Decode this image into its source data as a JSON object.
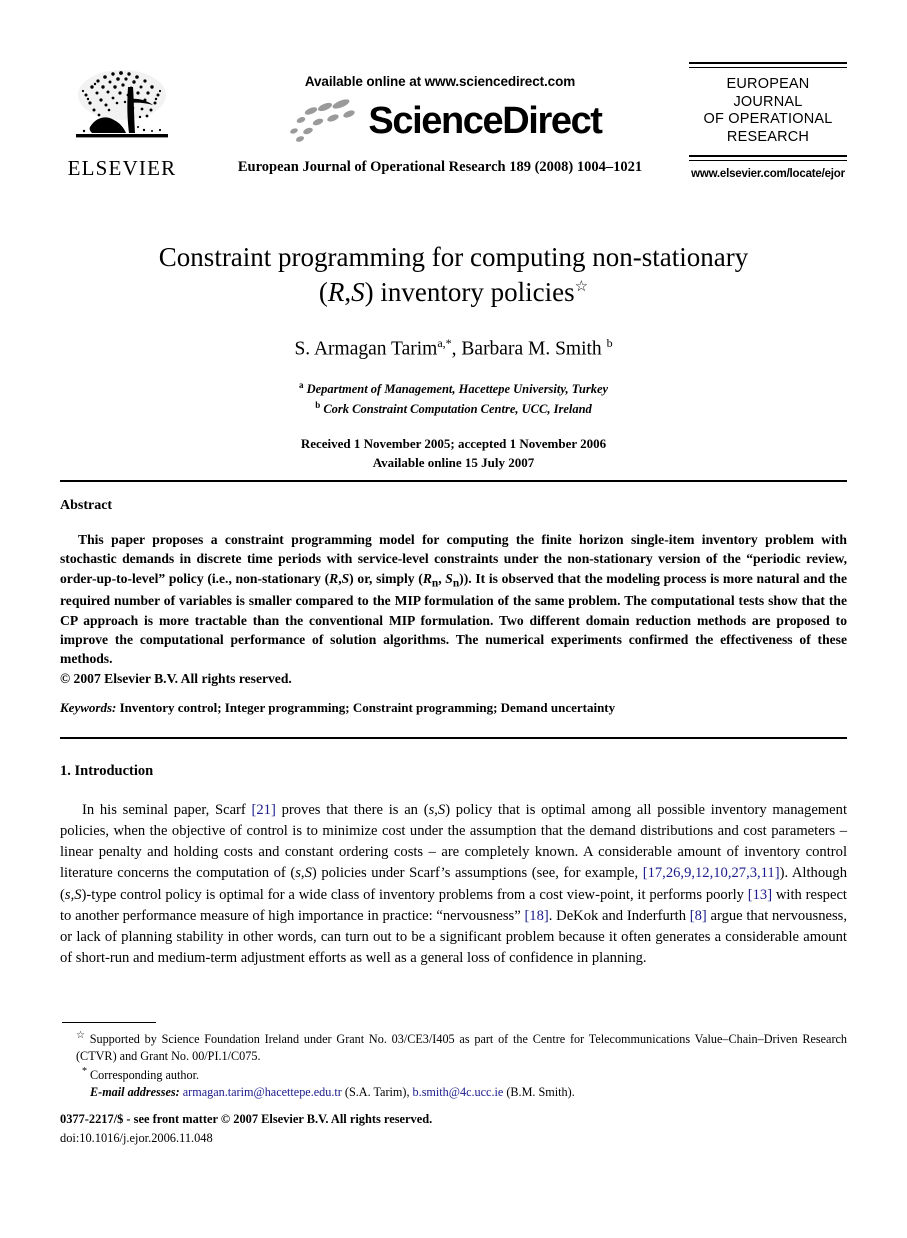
{
  "masthead": {
    "publisher_logo_text": "ELSEVIER",
    "available_online": "Available online at www.sciencedirect.com",
    "sciencedirect_wordmark": "ScienceDirect",
    "journal_citation_line": "European Journal of Operational Research 189 (2008) 1004–1021",
    "journal_box_title": "EUROPEAN JOURNAL OF OPERATIONAL RESEARCH",
    "journal_box_lines": [
      "EUROPEAN",
      "JOURNAL",
      "OF OPERATIONAL",
      "RESEARCH"
    ],
    "journal_url": "www.elsevier.com/locate/ejor"
  },
  "title_block": {
    "title_line1": "Constraint programming for computing non-stationary",
    "title_line2_pre": "(",
    "title_line2_math1": "R",
    "title_line2_comma": ",",
    "title_line2_math2": "S",
    "title_line2_post": ") inventory policies",
    "title_footnote_marker": "☆",
    "title_plain": "Constraint programming for computing non-stationary (R,S) inventory policies",
    "authors": "S. Armagan Tarim a,*, Barbara M. Smith b",
    "author1_name": "S. Armagan Tarim",
    "author1_sup": "a,*",
    "author2_name": "Barbara M. Smith",
    "author2_sup": "b",
    "affiliation_a_sup": "a",
    "affiliation_a": "Department of Management, Hacettepe University, Turkey",
    "affiliation_b_sup": "b",
    "affiliation_b": "Cork Constraint Computation Centre, UCC, Ireland",
    "received_line": "Received 1 November 2005; accepted 1 November 2006",
    "available_line": "Available online 15 July 2007"
  },
  "abstract": {
    "heading": "Abstract",
    "paragraph_part1": "This paper proposes a constraint programming model for computing the finite horizon single-item inventory problem with stochastic demands in discrete time periods with service-level constraints under the non-stationary version of the “periodic review, order-up-to-level” policy (i.e., non-stationary (",
    "math_R": "R",
    "math_S": "S",
    "paragraph_part2": ") or, simply (",
    "math_Rn": "R",
    "math_Rn_sub": "n",
    "math_Sn": "S",
    "math_Sn_sub": "n",
    "paragraph_part3": ")). It is observed that the modeling process is more natural and the required number of variables is smaller compared to the MIP formulation of the same problem. The computational tests show that the CP approach is more tractable than the conventional MIP formulation. Two different domain reduction methods are proposed to improve the computational performance of solution algorithms. The numerical experiments confirmed the effectiveness of these methods.",
    "copyright": "© 2007 Elsevier B.V. All rights reserved."
  },
  "keywords": {
    "label": "Keywords:",
    "value": "Inventory control; Integer programming; Constraint programming; Demand uncertainty"
  },
  "introduction": {
    "heading": "1. Introduction",
    "text_1": "In his seminal paper, Scarf ",
    "cite_1": "[21]",
    "text_2": " proves that there is an (",
    "math_s": "s",
    "math_S": "S",
    "text_3": ") policy that is optimal among all possible inventory management policies, when the objective of control is to minimize cost under the assumption that the demand distributions and cost parameters – linear penalty and holding costs and constant ordering costs – are completely known. A considerable amount of inventory control literature concerns the computation of (",
    "text_4": ") policies under Scarf’s assumptions (see, for example, ",
    "cite_2": "[17,26,9,12,10,27,3,11]",
    "text_5": "). Although (",
    "text_6": ")-type control policy is optimal for a wide class of inventory problems from a cost view-point, it performs poorly ",
    "cite_3": "[13]",
    "text_7": " with respect to another performance measure of high importance in practice: “nervousness” ",
    "cite_4": "[18]",
    "text_8": ". DeKok and Inderfurth ",
    "cite_5": "[8]",
    "text_9": " argue that nervousness, or lack of planning stability in other words, can turn out to be a significant problem because it often generates a considerable amount of short-run and medium-term adjustment efforts as well as a general loss of confidence in planning."
  },
  "footnotes": {
    "star_marker": "☆",
    "star_text": "Supported by Science Foundation Ireland under Grant No. 03/CE3/I405 as part of the Centre for Telecommunications Value–Chain–Driven Research (CTVR) and Grant No. 00/PI.1/C075.",
    "asterisk_marker": "*",
    "corresponding_text": "Corresponding author.",
    "email_label": "E-mail addresses:",
    "email_1": "armagan.tarim@hacettepe.edu.tr",
    "email_1_owner": " (S.A. Tarim), ",
    "email_2": "b.smith@4c.ucc.ie",
    "email_2_owner": " (B.M. Smith)."
  },
  "imprint": {
    "issn_line": "0377-2217/$ - see front matter © 2007 Elsevier B.V. All rights reserved.",
    "doi_line": "doi:10.1016/j.ejor.2006.11.048"
  },
  "colors": {
    "link": "#1a1a8c",
    "text": "#000000",
    "swoosh_gray": "#9a9a9a"
  }
}
